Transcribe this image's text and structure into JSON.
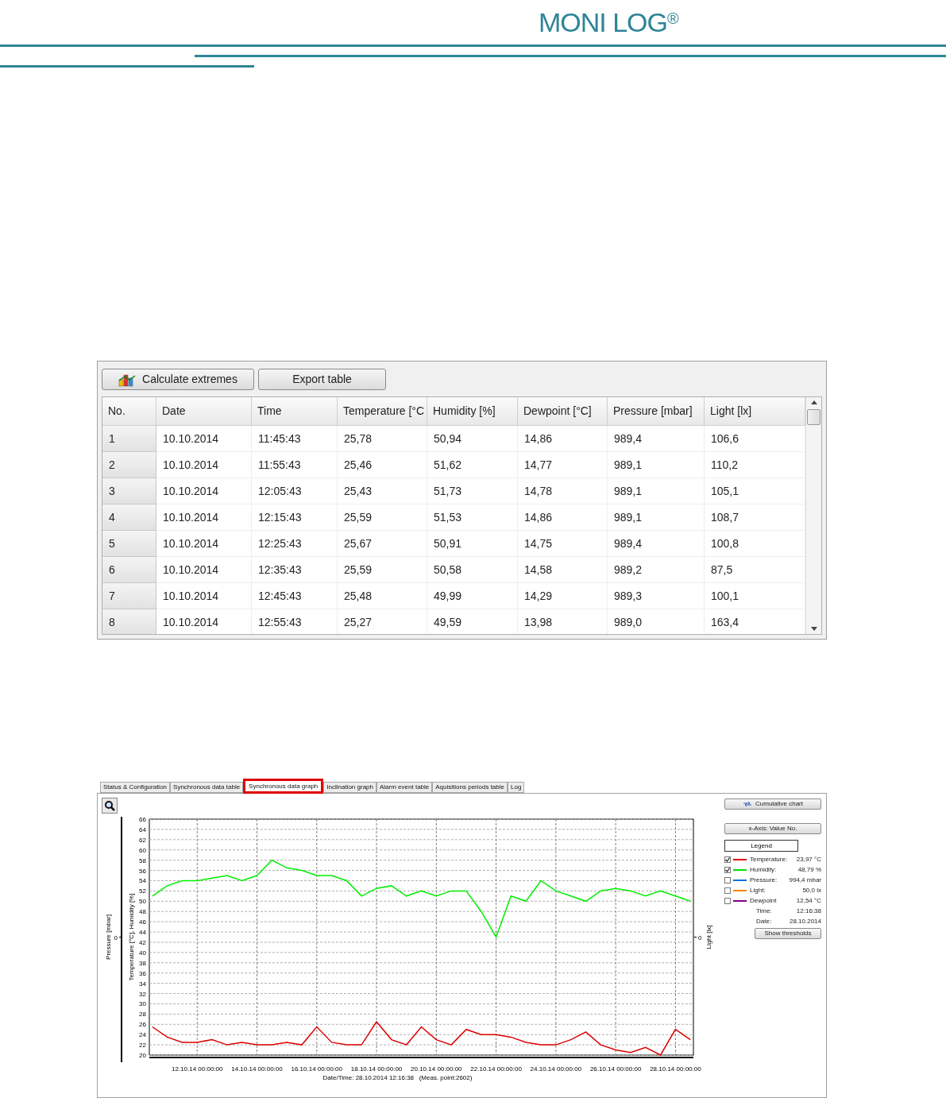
{
  "header": {
    "logo": "MONI LOG$^{®}$"
  },
  "data_table": {
    "buttons": [
      {
        "label": "Calculate extremes",
        "kind": "chart"
      },
      {
        "label": "Export table",
        "kind": "plain"
      }
    ],
    "columns": [
      "No.",
      "Date",
      "Time",
      "Temperature [°C",
      "Humidity [%]",
      "Dewpoint [°C]",
      "Pressure [mbar]",
      "Light [lx]"
    ],
    "rows": [
      [
        "1",
        "10.10.2014",
        "11:45:43",
        "25,78",
        "50,94",
        "14,86",
        "989,4",
        "106,6"
      ],
      [
        "2",
        "10.10.2014",
        "11:55:43",
        "25,46",
        "51,62",
        "14,77",
        "989,1",
        "110,2"
      ],
      [
        "3",
        "10.10.2014",
        "12:05:43",
        "25,43",
        "51,73",
        "14,78",
        "989,1",
        "105,1"
      ],
      [
        "4",
        "10.10.2014",
        "12:15:43",
        "25,59",
        "51,53",
        "14,86",
        "989,1",
        "108,7"
      ],
      [
        "5",
        "10.10.2014",
        "12:25:43",
        "25,67",
        "50,91",
        "14,75",
        "989,4",
        "100,8"
      ],
      [
        "6",
        "10.10.2014",
        "12:35:43",
        "25,59",
        "50,58",
        "14,58",
        "989,2",
        "87,5"
      ],
      [
        "7",
        "10.10.2014",
        "12:45:43",
        "25,48",
        "49,99",
        "14,29",
        "989,3",
        "100,1"
      ],
      [
        "8",
        "10.10.2014",
        "12:55:43",
        "25,27",
        "49,59",
        "13,98",
        "989,0",
        "163,4"
      ]
    ]
  },
  "graph_view": {
    "tabs": [
      {
        "label": "Status & Configuration",
        "selected": false
      },
      {
        "label": "Synchronous data table",
        "selected": false
      },
      {
        "label": "Synchronous data graph",
        "selected": true
      },
      {
        "label": "Inclination graph",
        "selected": false
      },
      {
        "label": "Alarm event table",
        "selected": false
      },
      {
        "label": "Aquisitions periods table",
        "selected": false
      },
      {
        "label": "Log",
        "selected": false
      }
    ],
    "cumulative_button": "Cumulative chart",
    "xaxis_button": "x-Axis: Value No.",
    "legend": {
      "title": "Legend",
      "items": [
        {
          "label": "Temperature:",
          "value": "23,97 °C",
          "checked": true,
          "color": "#e00000"
        },
        {
          "label": "Humidity:",
          "value": "48,79 %",
          "checked": true,
          "color": "#00e000"
        },
        {
          "label": "Pressure:",
          "value": "994,4 mbar",
          "checked": false,
          "color": "#0070e0"
        },
        {
          "label": "Light:",
          "value": "50,0 lx",
          "checked": false,
          "color": "#ff8000"
        },
        {
          "label": "Dewpoint",
          "value": "12,54 °C",
          "checked": false,
          "color": "#800080"
        }
      ],
      "readouts": [
        {
          "label": "Time:",
          "value": "12:16:38"
        },
        {
          "label": "Date:",
          "value": "28.10.2014"
        }
      ]
    },
    "thresholds_button": "Show thresholds",
    "left_axis": {
      "label": "Pressure [mbar]",
      "tick": "0"
    },
    "right_axis": {
      "label": "Light [lx]",
      "tick": "0"
    },
    "chart_data": {
      "type": "line",
      "ylabel": "Temperature [°C], Humidity [%]",
      "xlabel": "Date/Time: 28.10.2014 12:16:38   (Meas. point:2602)",
      "categories": [
        null,
        null,
        null,
        "12.10.14 00:00:00",
        null,
        null,
        null,
        "14.10.14 00:00:00",
        null,
        null,
        null,
        "16.10.14 00:00:00",
        null,
        null,
        null,
        "18.10.14 00:00:00",
        null,
        null,
        null,
        "20.10.14 00:00:00",
        null,
        null,
        null,
        "22.10.14 00:00:00",
        null,
        null,
        null,
        "24.10.14 00:00:00",
        null,
        null,
        null,
        "26.10.14 00:00:00",
        null,
        null,
        null,
        "28.10.14 00:00:00",
        null
      ],
      "series": [
        {
          "color": "#00ee00",
          "values": [
            51,
            53,
            54,
            54,
            54.5,
            55,
            54,
            55,
            58,
            56.5,
            56,
            55,
            55,
            54,
            51,
            52.5,
            53,
            51,
            52,
            51,
            52,
            52,
            48,
            43,
            51,
            50,
            54,
            52,
            51,
            50,
            52,
            52.5,
            52,
            51,
            52,
            51,
            50
          ]
        },
        {
          "color": "#dd0000",
          "values": [
            25.5,
            23.5,
            22.5,
            22.5,
            23,
            22,
            22.5,
            22,
            22,
            22.5,
            22,
            25.5,
            22.5,
            22,
            22,
            26.5,
            23,
            22,
            25.5,
            23,
            22,
            25,
            24,
            24,
            23.5,
            22.5,
            22,
            22,
            23,
            24.5,
            22,
            21,
            20.5,
            21.5,
            20,
            25,
            23
          ]
        }
      ],
      "grid": true,
      "ylim": [
        20,
        66
      ],
      "yticks": [
        20,
        22,
        24,
        26,
        28,
        30,
        32,
        34,
        36,
        38,
        40,
        42,
        44,
        46,
        48,
        50,
        52,
        54,
        56,
        58,
        60,
        62,
        64,
        66
      ]
    }
  }
}
